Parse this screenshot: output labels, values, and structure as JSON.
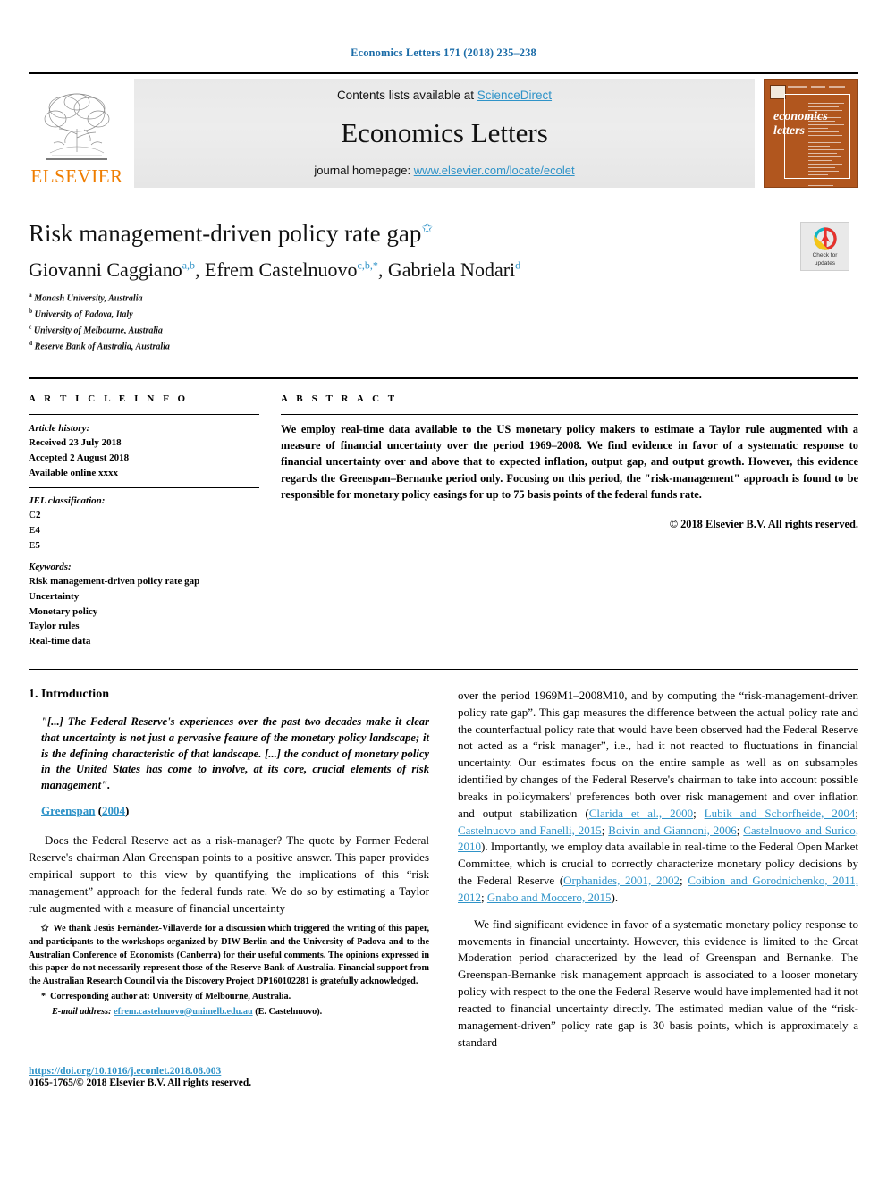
{
  "running_head": "Economics Letters 171 (2018) 235–238",
  "masthead": {
    "publisher_name": "ELSEVIER",
    "contents_prefix": "Contents lists available at ",
    "contents_link": "ScienceDirect",
    "journal_title": "Economics Letters",
    "homepage_prefix": "journal homepage: ",
    "homepage_url": "www.elsevier.com/locate/ecolet",
    "cover_line1": "economics",
    "cover_line2": "letters"
  },
  "title_block": {
    "title": "Risk management-driven policy rate gap",
    "title_footnote_mark": "✩",
    "authors_1": "Giovanni Caggiano",
    "authors_1_marks": "a,b",
    "authors_2": ", Efrem Castelnuovo",
    "authors_2_marks": "c,b,*",
    "authors_3": ", Gabriela Nodari",
    "authors_3_marks": "d",
    "affiliations": [
      {
        "mark": "a",
        "text": "Monash University, Australia"
      },
      {
        "mark": "b",
        "text": "University of Padova, Italy"
      },
      {
        "mark": "c",
        "text": "University of Melbourne, Australia"
      },
      {
        "mark": "d",
        "text": "Reserve Bank of Australia, Australia"
      }
    ],
    "crossmark_line1": "Check for",
    "crossmark_line2": "updates"
  },
  "article_info": {
    "heading": "A R T I C L E   I N F O",
    "history_label": "Article history:",
    "history": [
      "Received 23 July 2018",
      "Accepted 2 August 2018",
      "Available online xxxx"
    ],
    "jel_label": "JEL classification:",
    "jel": [
      "C2",
      "E4",
      "E5"
    ],
    "keywords_label": "Keywords:",
    "keywords": [
      "Risk management-driven policy rate gap",
      "Uncertainty",
      "Monetary policy",
      "Taylor rules",
      "Real-time data"
    ]
  },
  "abstract": {
    "heading": "A B S T R A C T",
    "text": "We employ real-time data available to the US monetary policy makers to estimate a Taylor rule augmented with a measure of financial uncertainty over the period 1969–2008. We find evidence in favor of a systematic response to financial uncertainty over and above that to expected inflation, output gap, and output growth. However, this evidence regards the Greenspan–Bernanke period only. Focusing on this period, the \"risk-management\" approach is found to be responsible for monetary policy easings for up to 75 basis points of the federal funds rate.",
    "copyright": "© 2018 Elsevier B.V. All rights reserved."
  },
  "body": {
    "section_number_title": "1. Introduction",
    "quote": "\"[...] The Federal Reserve's experiences over the past two decades make it clear that uncertainty is not just a pervasive feature of the monetary policy landscape; it is the defining characteristic of that landscape. [...] the conduct of monetary policy in the United States has come to involve, at its core, crucial elements of risk management\".",
    "quote_cite_author": "Greenspan",
    "quote_cite_year": "2004",
    "left_para_1": "Does the Federal Reserve act as a risk-manager? The quote by Former Federal Reserve's chairman Alan Greenspan points to a positive answer. This paper provides empirical support to this view by quantifying the implications of this “risk management” approach for the federal funds rate. We do so by estimating a Taylor rule augmented with a measure of financial uncertainty",
    "right_para_1_a": "over the period 1969M1–2008M10, and by computing the “risk-management-driven policy rate gap”. This gap measures the difference between the actual policy rate and the counterfactual policy rate that would have been observed had the Federal Reserve not acted as a “risk manager”, i.e., had it not reacted to fluctuations in financial uncertainty. Our estimates focus on the entire sample as well as on subsamples identified by changes of the Federal Reserve's chairman to take into account possible breaks in policymakers' preferences both over risk management and over inflation and output stabilization (",
    "right_para_1_cites_1": "Clarida et al., 2000",
    "right_para_1_sep1": "; ",
    "right_para_1_cites_2": "Lubik and Schorfheide, 2004",
    "right_para_1_sep2": "; ",
    "right_para_1_cites_3": "Castelnuovo and Fanelli, 2015",
    "right_para_1_sep3": "; ",
    "right_para_1_cites_4": "Boivin and Giannoni, 2006",
    "right_para_1_sep4": "; ",
    "right_para_1_cites_5": "Castelnuovo and Surico, 2010",
    "right_para_1_b": "). Importantly, we employ data available in real-time to the Federal Open Market Committee, which is crucial to correctly characterize monetary policy decisions by the Federal Reserve (",
    "right_para_1_cites_6": "Orphanides, 2001, 2002",
    "right_para_1_sep5": "; ",
    "right_para_1_cites_7": "Coibion and Gorodnichenko, 2011, 2012",
    "right_para_1_sep6": "; ",
    "right_para_1_cites_8": "Gnabo and Moccero, 2015",
    "right_para_1_c": ").",
    "right_para_2": "We find significant evidence in favor of a systematic monetary policy response to movements in financial uncertainty. However, this evidence is limited to the Great Moderation period characterized by the lead of Greenspan and Bernanke. The Greenspan-Bernanke risk management approach is associated to a looser monetary policy with respect to the one the Federal Reserve would have implemented had it not reacted to financial uncertainty directly. The estimated median value of the “risk-management-driven” policy rate gap is 30 basis points, which is approximately a standard"
  },
  "footnotes": {
    "star_mark": "✩",
    "star_text": "We thank Jesús Fernández-Villaverde for a discussion which triggered the writing of this paper, and participants to the workshops organized by DIW Berlin and the University of Padova and to the Australian Conference of Economists (Canberra) for their useful comments. The opinions expressed in this paper do not necessarily represent those of the Reserve Bank of Australia. Financial support from the Australian Research Council via the Discovery Project DP160102281 is gratefully acknowledged.",
    "asterisk_mark": "*",
    "corresponding_text": "Corresponding author at: University of Melbourne, Australia.",
    "email_label": "E-mail address:",
    "email": "efrem.castelnuovo@unimelb.edu.au",
    "email_suffix": "(E. Castelnuovo)."
  },
  "footer": {
    "doi": "https://doi.org/10.1016/j.econlet.2018.08.003",
    "issn_line": "0165-1765/© 2018 Elsevier B.V. All rights reserved."
  },
  "colors": {
    "link": "#2f93c8",
    "elsevier_orange": "#ef7d00",
    "cover_brown": "#b1561e"
  }
}
